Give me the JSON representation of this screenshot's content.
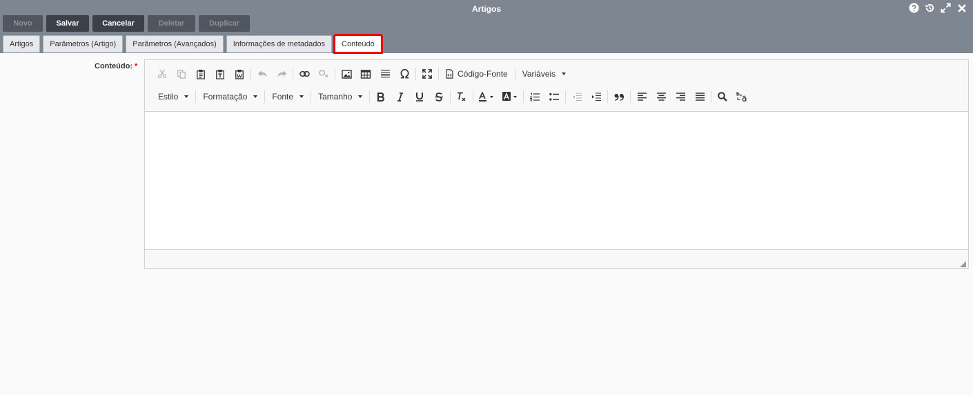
{
  "window": {
    "title": "Artigos"
  },
  "actions": [
    {
      "label": "Novo",
      "enabled": false
    },
    {
      "label": "Salvar",
      "enabled": true
    },
    {
      "label": "Cancelar",
      "enabled": true
    },
    {
      "label": "Deletar",
      "enabled": false
    },
    {
      "label": "Duplicar",
      "enabled": false
    }
  ],
  "tabs": [
    {
      "label": "Artigos"
    },
    {
      "label": "Parâmetros (Artigo)"
    },
    {
      "label": "Parâmetros (Avançados)"
    },
    {
      "label": "Informações de metadados"
    },
    {
      "label": "Conteúdo",
      "active": true
    }
  ],
  "field": {
    "label": "Conteúdo:",
    "required_mark": "*"
  },
  "toolbar": {
    "source_label": "Código-Fonte",
    "variables_label": "Variáveis",
    "style_label": "Estilo",
    "format_label": "Formatação",
    "font_label": "Fonte",
    "size_label": "Tamanho"
  },
  "colors": {
    "header": "#7e8691",
    "active_tab_outline": "#ee0000"
  }
}
